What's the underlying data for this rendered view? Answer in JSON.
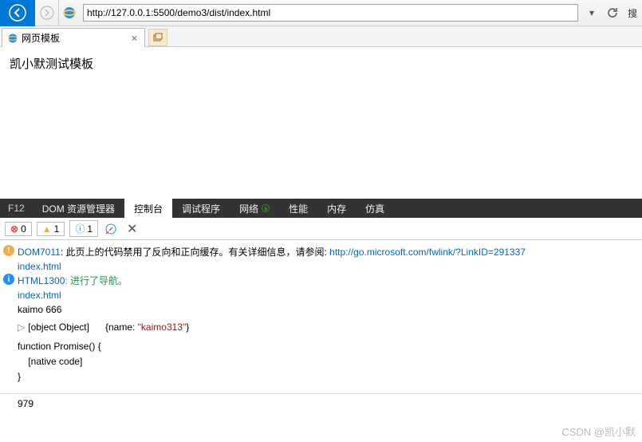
{
  "nav": {
    "url": "http://127.0.0.1:5500/demo3/dist/index.html",
    "search_label": "搜"
  },
  "tab": {
    "title": "网页模板"
  },
  "page": {
    "heading": "凯小默测试模板"
  },
  "devtools": {
    "f12": "F12",
    "tabs": {
      "dom": "DOM 资源管理器",
      "console": "控制台",
      "debugger": "调试程序",
      "network": "网络",
      "performance": "性能",
      "memory": "内存",
      "emulation": "仿真"
    },
    "counts": {
      "errors": "0",
      "warnings": "1",
      "info": "1"
    }
  },
  "console": {
    "l1": {
      "code": "DOM7011",
      "msg": ": 此页上的代码禁用了反向和正向缓存。有关详细信息，请参阅: ",
      "link": "http://go.microsoft.com/fwlink/?LinkID=291337",
      "file": "index.html"
    },
    "l2": {
      "code": "HTML1300",
      "msg": ": 进行了导航。",
      "file": "index.html"
    },
    "l3": "kaimo 666",
    "l4": {
      "obj": "[object Object]",
      "preview_open": "{name: ",
      "preview_val": "\"kaimo313\"",
      "preview_close": "}"
    },
    "l5": "function Promise() {\n    [native code]\n}",
    "l6": "979"
  },
  "watermark": "CSDN @凯小默"
}
